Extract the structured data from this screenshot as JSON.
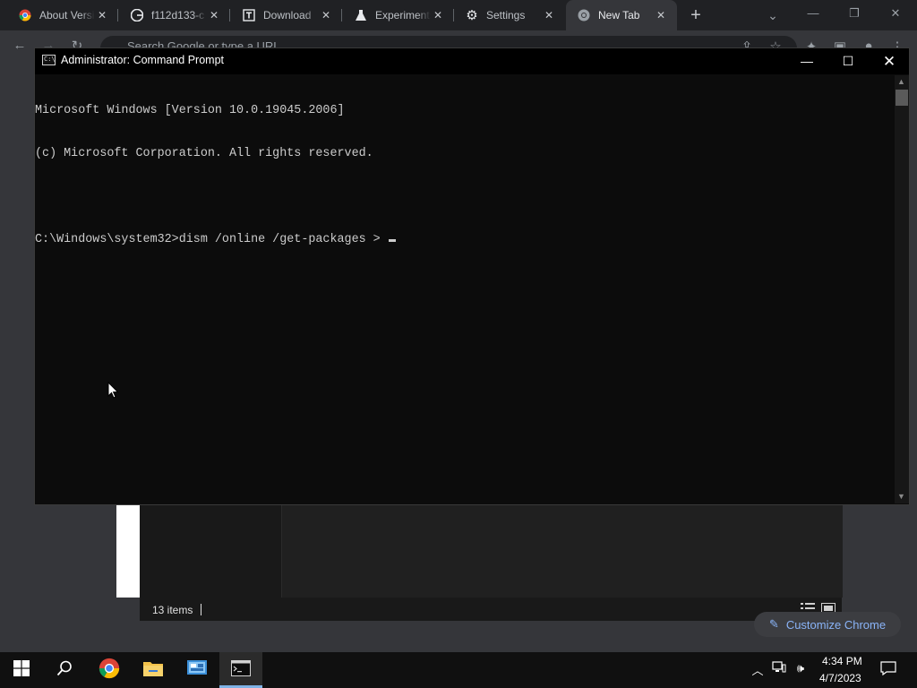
{
  "browser": {
    "tabs": [
      {
        "label": "About Version",
        "icon": "chrome-logo-icon"
      },
      {
        "label": "f112d133-c",
        "icon": "google-g-icon"
      },
      {
        "label": "Download",
        "icon": "t-logo-icon"
      },
      {
        "label": "Experiments",
        "icon": "flask-icon"
      },
      {
        "label": "Settings",
        "icon": "gear-icon"
      },
      {
        "label": "New Tab",
        "icon": "chrome-logo-icon"
      }
    ],
    "omnibox_placeholder": "Search Google or type a URL",
    "customize_label": "Customize Chrome"
  },
  "explorer": {
    "status_items": "13 items"
  },
  "cmd": {
    "title": "Administrator: Command Prompt",
    "lines": [
      "Microsoft Windows [Version 10.0.19045.2006]",
      "(c) Microsoft Corporation. All rights reserved.",
      "",
      "C:\\Windows\\system32>dism /online /get-packages > "
    ]
  },
  "taskbar": {
    "time": "4:34 PM",
    "date": "4/7/2023"
  },
  "colors": {
    "accent": "#7fb3e6",
    "link": "#8ab4f8",
    "console_text": "#cccccc"
  }
}
